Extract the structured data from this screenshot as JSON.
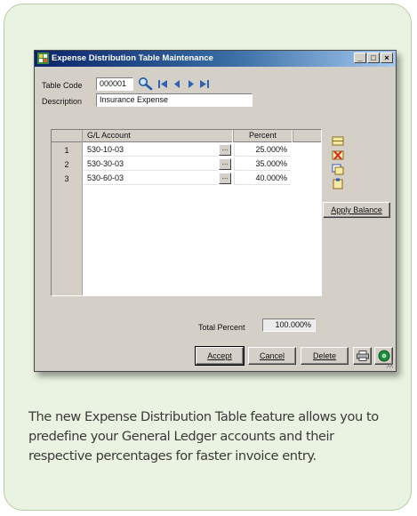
{
  "window": {
    "title": "Expense Distribution Table Maintenance",
    "controls": [
      "_",
      "□",
      "×"
    ]
  },
  "header": {
    "table_code_label": "Table Code",
    "table_code_value": "000001",
    "description_label": "Description",
    "description_value": "Insurance Expense"
  },
  "grid": {
    "columns": [
      "G/L Account",
      "Percent"
    ],
    "rows": [
      {
        "num": "1",
        "account": "530-10-03",
        "percent": "25.000%"
      },
      {
        "num": "2",
        "account": "530-30-03",
        "percent": "35.000%"
      },
      {
        "num": "3",
        "account": "530-60-03",
        "percent": "40.000%"
      }
    ],
    "ellipsis": "..."
  },
  "side": {
    "apply_balance": "Apply Balance",
    "icons": [
      "insert-row-icon",
      "delete-row-icon",
      "copy-row-icon",
      "paste-row-icon"
    ]
  },
  "totals": {
    "label": "Total Percent",
    "value": "100.000%"
  },
  "buttons": {
    "accept": "Accept",
    "cancel": "Cancel",
    "delete": "Delete"
  },
  "caption": "The new Expense Distribution Table feature allows you to predefine your General Ledger accounts and their respective percentages for faster invoice entry.",
  "colors": {
    "card_bg": "#eaf3e1",
    "titlebar": "#0a246a",
    "window_bg": "#d4d0c8"
  }
}
